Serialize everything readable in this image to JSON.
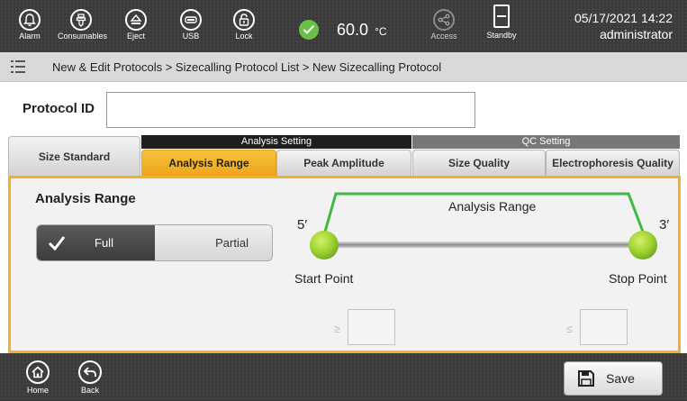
{
  "topbar": {
    "buttons": [
      {
        "label": "Alarm",
        "icon": "bell-icon"
      },
      {
        "label": "Consumables",
        "icon": "consumables-icon"
      },
      {
        "label": "Eject",
        "icon": "eject-icon"
      },
      {
        "label": "USB",
        "icon": "usb-icon"
      },
      {
        "label": "Lock",
        "icon": "lock-icon"
      }
    ],
    "temperature": {
      "value": "60.0",
      "unit": "°C",
      "status_color": "#6cc04a"
    },
    "access_label": "Access",
    "standby_label": "Standby",
    "date_time": "05/17/2021 14:22",
    "user": "administrator"
  },
  "breadcrumb": {
    "text": "New & Edit Protocols > Sizecalling Protocol List > New Sizecalling Protocol"
  },
  "protocol_id": {
    "label": "Protocol ID",
    "value": "",
    "placeholder": ""
  },
  "tabs": {
    "size_standard": "Size Standard",
    "group_analysis": "Analysis Setting",
    "group_qc": "QC Setting",
    "analysis_range": "Analysis Range",
    "peak_amplitude": "Peak Amplitude",
    "size_quality": "Size Quality",
    "electrophoresis_quality": "Electrophoresis Quality",
    "active": "Analysis Range"
  },
  "analysis_range": {
    "title": "Analysis Range",
    "options": {
      "full": "Full",
      "partial": "Partial"
    },
    "selected": "Full",
    "diagram": {
      "title": "Analysis Range",
      "left_end": "5′",
      "right_end": "3′",
      "start_label": "Start Point",
      "stop_label": "Stop Point"
    },
    "start_operator": "≥",
    "start_value": "",
    "stop_operator": "≤",
    "stop_value": ""
  },
  "bottombar": {
    "home_label": "Home",
    "back_label": "Back",
    "save_label": "Save"
  },
  "colors": {
    "accent": "#f2b02d",
    "range_line": "#3fba3f",
    "point": "#8fce2e"
  }
}
